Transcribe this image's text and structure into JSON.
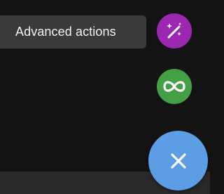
{
  "tooltip": {
    "label": "Advanced actions"
  },
  "actions": [
    {
      "name": "advanced-actions",
      "icon": "magic-wand-icon",
      "color": "#9c27b0"
    },
    {
      "name": "loop",
      "icon": "infinity-icon",
      "color": "#43a047"
    }
  ],
  "main_fab": {
    "icon": "close-icon",
    "color": "#5b9ee6"
  },
  "colors": {
    "background": "#141414",
    "tooltip_bg": "#3a3a3a",
    "tooltip_text": "#f2f2f2",
    "bottom_bar": "#2a2a2a"
  }
}
